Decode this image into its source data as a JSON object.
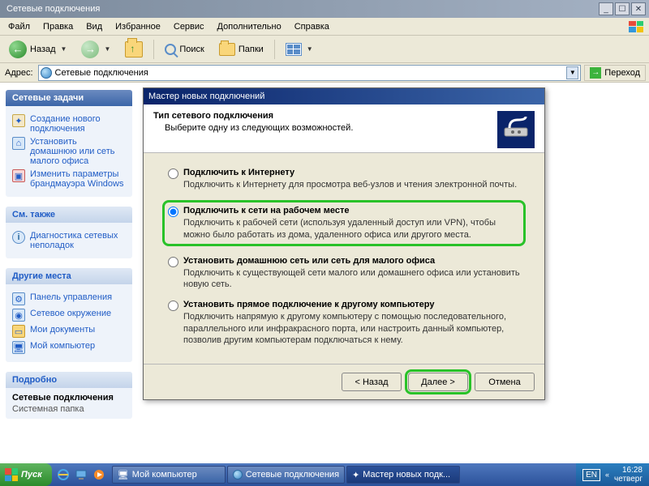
{
  "window": {
    "title": "Сетевые подключения"
  },
  "menu": {
    "file": "Файл",
    "edit": "Правка",
    "view": "Вид",
    "favorites": "Избранное",
    "tools": "Сервис",
    "extra": "Дополнительно",
    "help": "Справка"
  },
  "toolbar": {
    "back": "Назад",
    "search": "Поиск",
    "folders": "Папки"
  },
  "address": {
    "label": "Адрес:",
    "value": "Сетевые подключения",
    "go": "Переход"
  },
  "sidebar": {
    "tasks": {
      "title": "Сетевые задачи",
      "items": [
        "Создание нового подключения",
        "Установить домашнюю или сеть малого офиса",
        "Изменить параметры брандмауэра Windows"
      ]
    },
    "see_also": {
      "title": "См. также",
      "items": [
        "Диагностика сетевых неполадок"
      ]
    },
    "other": {
      "title": "Другие места",
      "items": [
        "Панель управления",
        "Сетевое окружение",
        "Мои документы",
        "Мой компьютер"
      ]
    },
    "details": {
      "title": "Подробно",
      "name": "Сетевые подключения",
      "type": "Системная папка"
    }
  },
  "wizard": {
    "title": "Мастер новых подключений",
    "heading": "Тип сетевого подключения",
    "subheading": "Выберите одну из следующих возможностей.",
    "options": [
      {
        "label": "Подключить к Интернету",
        "desc": "Подключить к Интернету для просмотра веб-узлов и чтения электронной почты.",
        "selected": false
      },
      {
        "label": "Подключить к сети на рабочем месте",
        "desc": "Подключить к рабочей сети (используя удаленный доступ или VPN), чтобы можно было работать из дома, удаленного офиса или другого места.",
        "selected": true
      },
      {
        "label": "Установить домашнюю сеть или сеть для малого офиса",
        "desc": "Подключить к существующей сети малого или домашнего офиса или установить новую сеть.",
        "selected": false
      },
      {
        "label": "Установить прямое подключение к другому компьютеру",
        "desc": "Подключить напрямую к другому компьютеру с помощью последовательного, параллельного или инфракрасного порта, или настроить данный компьютер, позволив другим компьютерам подключаться к нему.",
        "selected": false
      }
    ],
    "buttons": {
      "back": "< Назад",
      "next": "Далее >",
      "cancel": "Отмена"
    }
  },
  "taskbar": {
    "start": "Пуск",
    "tasks": [
      "Мой компьютер",
      "Сетевые подключения",
      "Мастер новых подк..."
    ],
    "lang": "EN",
    "time": "16:28",
    "day": "четверг"
  }
}
